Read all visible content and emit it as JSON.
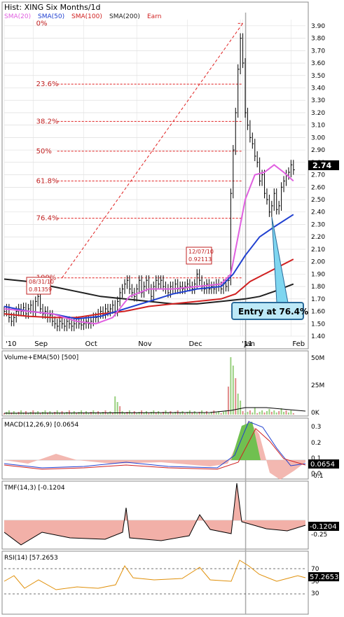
{
  "main": {
    "title": "Hist: XING Six Months/1d",
    "legend": [
      {
        "label": "SMA(20)",
        "color": "#e060e0"
      },
      {
        "label": "SMA(50)",
        "color": "#2040d0"
      },
      {
        "label": "SMA(100)",
        "color": "#d02020"
      },
      {
        "label": "SMA(200)",
        "color": "#202020"
      },
      {
        "label": "Earn",
        "color": "#d02020"
      }
    ],
    "last_price": "2.74",
    "callout": "Entry at 76.4%",
    "note_1": {
      "date": "08/31/10",
      "value": "0.81359"
    },
    "note_2": {
      "date": "12/07/10",
      "value": "0.92113"
    },
    "fib_levels": [
      {
        "label": "0%",
        "value": 3.92
      },
      {
        "label": "23.6%",
        "value": 3.43
      },
      {
        "label": "38.2%",
        "value": 3.13
      },
      {
        "label": "50%",
        "value": 2.89
      },
      {
        "label": "61.8%",
        "value": 2.65
      },
      {
        "label": "76.4%",
        "value": 2.35
      },
      {
        "label": "100%",
        "value": 1.87
      }
    ],
    "x_labels": [
      {
        "label": "'10",
        "x": 0
      },
      {
        "label": "Sep",
        "x": 12
      },
      {
        "label": "Oct",
        "x": 33
      },
      {
        "label": "Nov",
        "x": 55
      },
      {
        "label": "Dec",
        "x": 76
      },
      {
        "label": "'11",
        "x": 98
      },
      {
        "label": "Jan",
        "x": 99
      },
      {
        "label": "Feb",
        "x": 119
      }
    ]
  },
  "volume_panel": {
    "title": "Volume+EMA(50)",
    "value": "[500]",
    "axis": [
      "50M",
      "25M",
      "0K"
    ]
  },
  "macd_panel": {
    "title": "MACD(12,26,9)",
    "value": "[0.0654",
    "last": "0.0654",
    "axis": [
      "0.3",
      "0.2",
      "0.1",
      "0.0",
      "-0.1"
    ]
  },
  "tmf_panel": {
    "title": "TMF(14,3)",
    "value": "[-0.1204",
    "last": "-0.1204",
    "axis": [
      "-0.25"
    ]
  },
  "rsi_panel": {
    "title": "RSI(14)",
    "value": "[57.2653",
    "last": "57.2653",
    "axis": [
      "70",
      "50",
      "30"
    ]
  },
  "chart_data": {
    "type": "line",
    "title": "Hist: XING Six Months/1d",
    "ylim": [
      1.4,
      3.95
    ],
    "y_ticks": [
      1.4,
      1.5,
      1.6,
      1.7,
      1.8,
      1.9,
      2.0,
      2.1,
      2.2,
      2.3,
      2.4,
      2.5,
      2.6,
      2.7,
      2.8,
      2.9,
      3.0,
      3.1,
      3.2,
      3.3,
      3.4,
      3.5,
      3.6,
      3.7,
      3.8,
      3.9
    ],
    "x_range": [
      0,
      125
    ],
    "price_close": [
      [
        0,
        1.6
      ],
      [
        1,
        1.62
      ],
      [
        2,
        1.55
      ],
      [
        3,
        1.52
      ],
      [
        4,
        1.55
      ],
      [
        5,
        1.6
      ],
      [
        6,
        1.62
      ],
      [
        7,
        1.6
      ],
      [
        8,
        1.63
      ],
      [
        9,
        1.58
      ],
      [
        10,
        1.62
      ],
      [
        11,
        1.65
      ],
      [
        12,
        1.6
      ],
      [
        13,
        1.68
      ],
      [
        14,
        1.72
      ],
      [
        15,
        1.62
      ],
      [
        16,
        1.58
      ],
      [
        17,
        1.6
      ],
      [
        18,
        1.55
      ],
      [
        19,
        1.57
      ],
      [
        20,
        1.52
      ],
      [
        21,
        1.5
      ],
      [
        22,
        1.48
      ],
      [
        23,
        1.52
      ],
      [
        24,
        1.5
      ],
      [
        25,
        1.48
      ],
      [
        26,
        1.52
      ],
      [
        27,
        1.5
      ],
      [
        28,
        1.48
      ],
      [
        29,
        1.5
      ],
      [
        30,
        1.52
      ],
      [
        31,
        1.5
      ],
      [
        32,
        1.49
      ],
      [
        33,
        1.5
      ],
      [
        34,
        1.52
      ],
      [
        35,
        1.5
      ],
      [
        36,
        1.52
      ],
      [
        37,
        1.55
      ],
      [
        38,
        1.55
      ],
      [
        39,
        1.58
      ],
      [
        40,
        1.6
      ],
      [
        41,
        1.58
      ],
      [
        42,
        1.62
      ],
      [
        43,
        1.6
      ],
      [
        44,
        1.62
      ],
      [
        45,
        1.65
      ],
      [
        46,
        1.6
      ],
      [
        47,
        1.68
      ],
      [
        48,
        1.75
      ],
      [
        49,
        1.78
      ],
      [
        50,
        1.82
      ],
      [
        51,
        1.85
      ],
      [
        52,
        1.78
      ],
      [
        53,
        1.75
      ],
      [
        54,
        1.72
      ],
      [
        55,
        1.78
      ],
      [
        56,
        1.85
      ],
      [
        57,
        1.75
      ],
      [
        58,
        1.8
      ],
      [
        59,
        1.85
      ],
      [
        60,
        1.78
      ],
      [
        61,
        1.72
      ],
      [
        62,
        1.8
      ],
      [
        63,
        1.85
      ],
      [
        64,
        1.82
      ],
      [
        65,
        1.85
      ],
      [
        66,
        1.8
      ],
      [
        67,
        1.78
      ],
      [
        68,
        1.75
      ],
      [
        69,
        1.8
      ],
      [
        70,
        1.78
      ],
      [
        71,
        1.82
      ],
      [
        72,
        1.78
      ],
      [
        73,
        1.8
      ],
      [
        74,
        1.78
      ],
      [
        75,
        1.8
      ],
      [
        76,
        1.82
      ],
      [
        77,
        1.8
      ],
      [
        78,
        1.78
      ],
      [
        79,
        1.82
      ],
      [
        80,
        1.9
      ],
      [
        81,
        1.85
      ],
      [
        82,
        1.8
      ],
      [
        83,
        1.78
      ],
      [
        84,
        1.82
      ],
      [
        85,
        1.78
      ],
      [
        86,
        1.8
      ],
      [
        87,
        1.78
      ],
      [
        88,
        1.82
      ],
      [
        89,
        1.8
      ],
      [
        90,
        1.78
      ],
      [
        91,
        1.82
      ],
      [
        92,
        1.8
      ],
      [
        93,
        1.85
      ],
      [
        94,
        2.55
      ],
      [
        95,
        2.9
      ],
      [
        96,
        3.2
      ],
      [
        97,
        3.55
      ],
      [
        98,
        3.8
      ],
      [
        99,
        3.6
      ],
      [
        100,
        3.2
      ],
      [
        101,
        3.1
      ],
      [
        102,
        3.0
      ],
      [
        103,
        2.95
      ],
      [
        104,
        2.85
      ],
      [
        105,
        2.8
      ],
      [
        106,
        2.65
      ],
      [
        107,
        2.7
      ],
      [
        108,
        2.55
      ],
      [
        109,
        2.5
      ],
      [
        110,
        2.4
      ],
      [
        111,
        2.45
      ],
      [
        112,
        2.55
      ],
      [
        113,
        2.42
      ],
      [
        114,
        2.45
      ],
      [
        115,
        2.6
      ],
      [
        116,
        2.65
      ],
      [
        117,
        2.7
      ],
      [
        118,
        2.72
      ],
      [
        119,
        2.78
      ],
      [
        120,
        2.74
      ]
    ],
    "sma20": [
      [
        0,
        1.62
      ],
      [
        10,
        1.6
      ],
      [
        20,
        1.58
      ],
      [
        30,
        1.52
      ],
      [
        38,
        1.5
      ],
      [
        45,
        1.55
      ],
      [
        52,
        1.72
      ],
      [
        60,
        1.78
      ],
      [
        70,
        1.78
      ],
      [
        80,
        1.8
      ],
      [
        90,
        1.82
      ],
      [
        94,
        1.9
      ],
      [
        97,
        2.2
      ],
      [
        100,
        2.5
      ],
      [
        104,
        2.7
      ],
      [
        108,
        2.72
      ],
      [
        112,
        2.78
      ],
      [
        116,
        2.72
      ],
      [
        120,
        2.65
      ]
    ],
    "sma50": [
      [
        0,
        1.64
      ],
      [
        10,
        1.6
      ],
      [
        20,
        1.58
      ],
      [
        30,
        1.54
      ],
      [
        40,
        1.56
      ],
      [
        50,
        1.62
      ],
      [
        60,
        1.68
      ],
      [
        70,
        1.74
      ],
      [
        80,
        1.78
      ],
      [
        90,
        1.8
      ],
      [
        95,
        1.9
      ],
      [
        100,
        2.05
      ],
      [
        106,
        2.2
      ],
      [
        112,
        2.28
      ],
      [
        120,
        2.38
      ]
    ],
    "sma100": [
      [
        0,
        1.58
      ],
      [
        10,
        1.56
      ],
      [
        20,
        1.55
      ],
      [
        30,
        1.55
      ],
      [
        40,
        1.58
      ],
      [
        50,
        1.6
      ],
      [
        60,
        1.64
      ],
      [
        70,
        1.66
      ],
      [
        80,
        1.68
      ],
      [
        90,
        1.7
      ],
      [
        96,
        1.74
      ],
      [
        102,
        1.84
      ],
      [
        108,
        1.9
      ],
      [
        114,
        1.96
      ],
      [
        120,
        2.02
      ]
    ],
    "sma200": [
      [
        0,
        1.86
      ],
      [
        10,
        1.84
      ],
      [
        20,
        1.8
      ],
      [
        30,
        1.76
      ],
      [
        40,
        1.72
      ],
      [
        50,
        1.7
      ],
      [
        60,
        1.68
      ],
      [
        70,
        1.66
      ],
      [
        80,
        1.66
      ],
      [
        90,
        1.68
      ],
      [
        100,
        1.7
      ],
      [
        106,
        1.72
      ],
      [
        112,
        1.76
      ],
      [
        120,
        1.82
      ]
    ]
  }
}
